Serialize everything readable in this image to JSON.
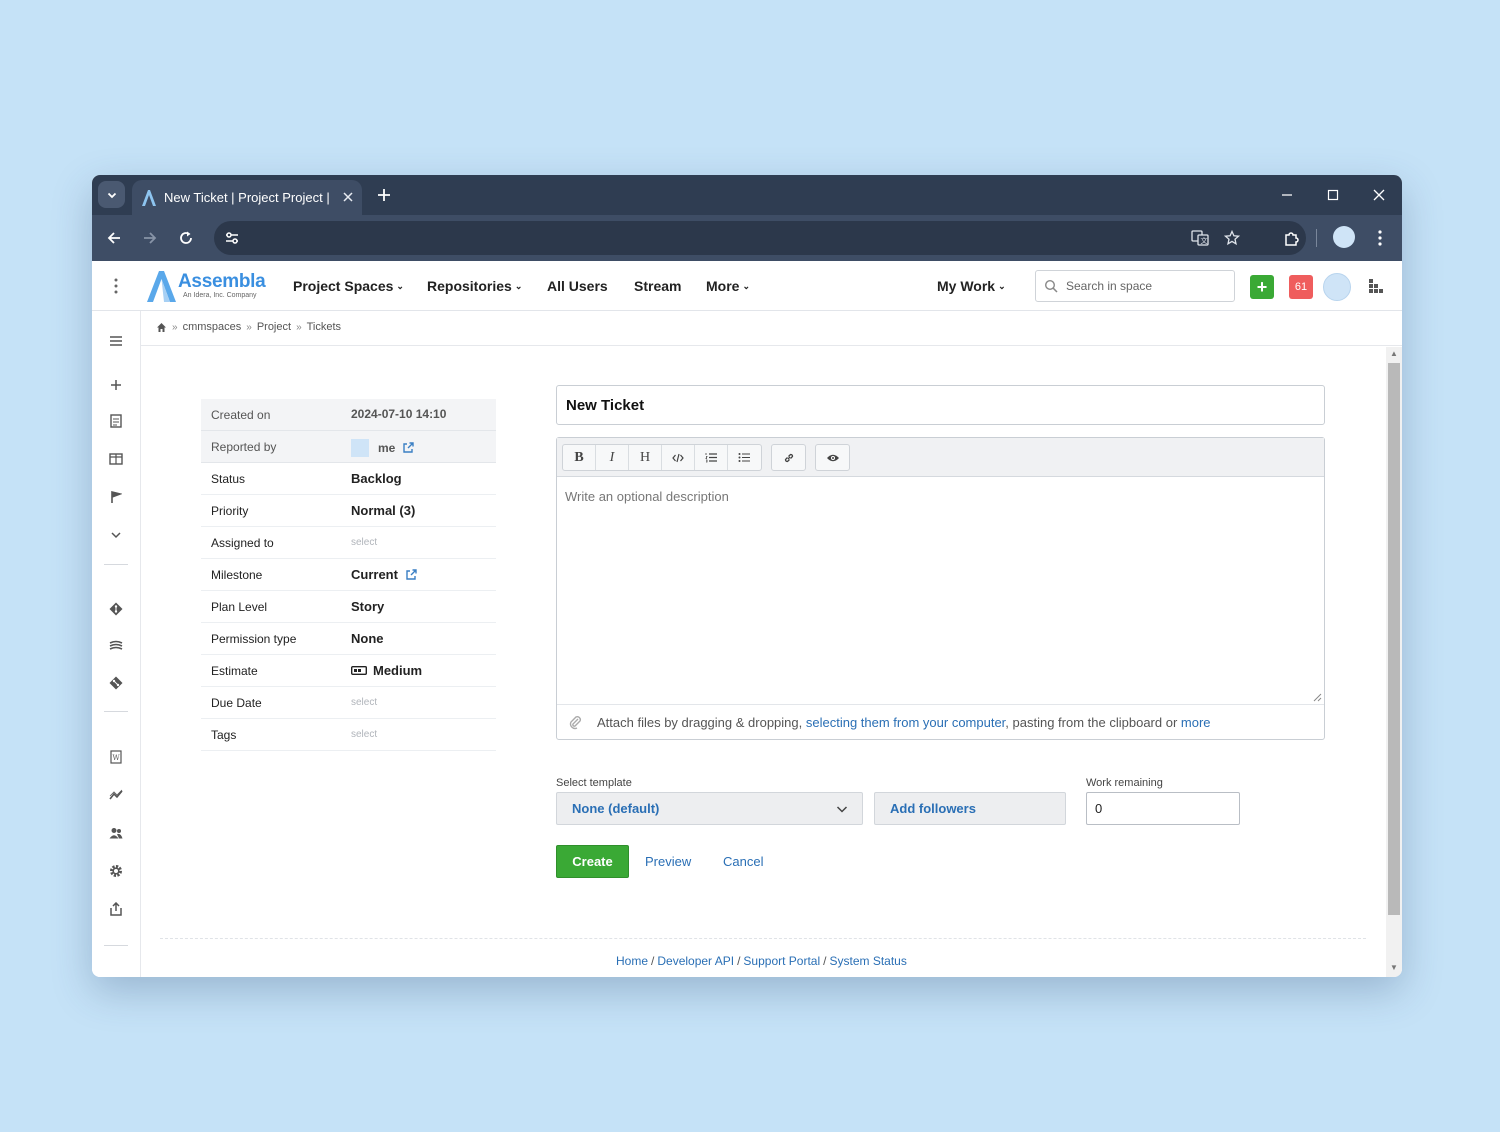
{
  "browser": {
    "tab_title": "New Ticket | Project Project | Assembla",
    "new_tab_label": "+"
  },
  "app": {
    "logo_name": "Assembla",
    "logo_tagline": "An Idera, Inc. Company",
    "nav": {
      "project_spaces": "Project Spaces",
      "repositories": "Repositories",
      "all_users": "All Users",
      "stream": "Stream",
      "more": "More",
      "my_work": "My Work"
    },
    "search_placeholder": "Search in space",
    "notification_count": "61",
    "plus_label": "+"
  },
  "breadcrumb": {
    "items": [
      "cmmspaces",
      "Project",
      "Tickets"
    ]
  },
  "properties": {
    "created_on": {
      "label": "Created on",
      "value": "2024-07-10 14:10"
    },
    "reported_by": {
      "label": "Reported by",
      "value": "me"
    },
    "status": {
      "label": "Status",
      "value": "Backlog"
    },
    "priority": {
      "label": "Priority",
      "value": "Normal (3)"
    },
    "assigned_to": {
      "label": "Assigned to",
      "value": "select"
    },
    "milestone": {
      "label": "Milestone",
      "value": "Current"
    },
    "plan_level": {
      "label": "Plan Level",
      "value": "Story"
    },
    "permission_type": {
      "label": "Permission type",
      "value": "None"
    },
    "estimate": {
      "label": "Estimate",
      "value": "Medium"
    },
    "due_date": {
      "label": "Due Date",
      "value": "select"
    },
    "tags": {
      "label": "Tags",
      "value": "select"
    }
  },
  "form": {
    "title_value": "New Ticket",
    "description_placeholder": "Write an optional description",
    "toolbar": {
      "bold": "B",
      "italic": "I",
      "heading": "H"
    },
    "attach": {
      "prefix": "Attach files by dragging & dropping,",
      "link_select": "selecting them from your computer",
      "middle": ", pasting from the clipboard or",
      "link_more": "more"
    },
    "template_label": "Select template",
    "template_value": "None (default)",
    "add_followers": "Add followers",
    "work_remaining_label": "Work remaining",
    "work_remaining_value": "0",
    "create": "Create",
    "preview": "Preview",
    "cancel": "Cancel"
  },
  "footer": {
    "home": "Home",
    "developer_api": "Developer API",
    "support_portal": "Support Portal",
    "system_status": "System Status"
  },
  "colors": {
    "page_bg": "#c5e2f7",
    "browser_chrome": "#3e4d65",
    "accent_blue": "#2a6fb5",
    "create_green": "#3aa935",
    "notif_red": "#ef5d5d"
  }
}
